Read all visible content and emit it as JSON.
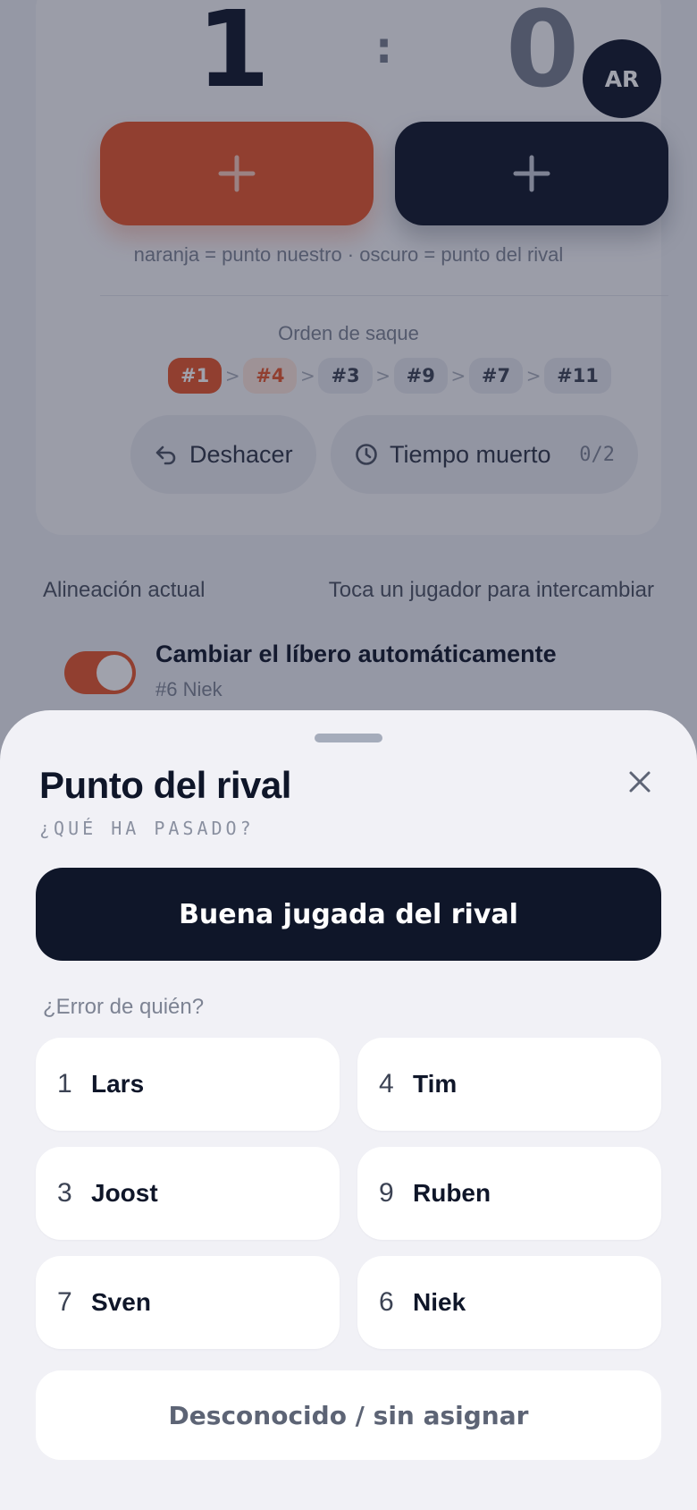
{
  "scoreboard": {
    "home_score": "1",
    "separator": ":",
    "away_score": "0",
    "avatar_initials": "AR",
    "legend": "naranja = punto nuestro · oscuro = punto del rival"
  },
  "serve_order": {
    "title": "Orden de saque",
    "chips": [
      "#1",
      "#4",
      "#3",
      "#9",
      "#7",
      "#11"
    ],
    "arrow": ">"
  },
  "actions": {
    "undo_label": "Deshacer",
    "timeout_label": "Tiempo muerto",
    "timeout_count": "0/2"
  },
  "lineup": {
    "label": "Alineación actual",
    "hint": "Toca un jugador para intercambiar",
    "libero_toggle_label": "Cambiar el líbero automáticamente",
    "libero_player": "#6 Niek",
    "libero_toggle_on": true
  },
  "sheet": {
    "title": "Punto del rival",
    "subtitle": "¿QUÉ HA PASADO?",
    "good_play_label": "Buena jugada del rival",
    "error_label": "¿Error de quién?",
    "players": [
      {
        "number": "1",
        "name": "Lars"
      },
      {
        "number": "4",
        "name": "Tim"
      },
      {
        "number": "3",
        "name": "Joost"
      },
      {
        "number": "9",
        "name": "Ruben"
      },
      {
        "number": "7",
        "name": "Sven"
      },
      {
        "number": "6",
        "name": "Niek"
      }
    ],
    "unknown_label": "Desconocido / sin asignar"
  },
  "colors": {
    "accent": "#e6552a",
    "dark": "#0f1629",
    "sheet_bg": "#f1f1f6"
  },
  "icons": {
    "plus": "plus-icon",
    "undo": "undo-arrow-icon",
    "timeout": "clock-icon",
    "close": "close-icon"
  }
}
